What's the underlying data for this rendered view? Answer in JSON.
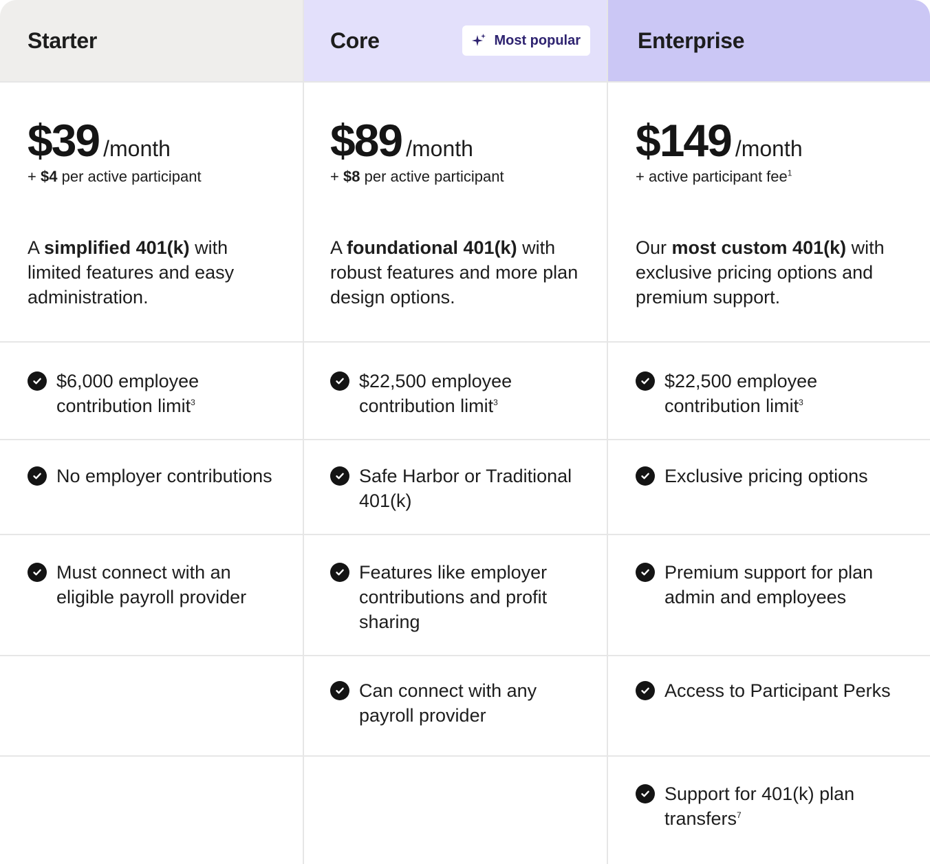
{
  "plans": [
    {
      "name": "Starter",
      "badge": null,
      "price": "$39",
      "per": "/month",
      "fee": {
        "prefix": "+",
        "amount": "$4",
        "suffix": "per active participant",
        "sup": ""
      },
      "desc": {
        "pre": "A",
        "bold": "simplified 401(k)",
        "post": "with limited features and easy administration."
      },
      "features": [
        {
          "text": "$6,000 employee contribution limit",
          "sup": "3"
        },
        {
          "text": "No employer contributions",
          "sup": ""
        },
        {
          "text": "Must connect with an eligible payroll provider",
          "sup": ""
        },
        null,
        null
      ]
    },
    {
      "name": "Core",
      "badge": {
        "label": "Most popular",
        "icon": "sparkle-icon"
      },
      "price": "$89",
      "per": "/month",
      "fee": {
        "prefix": "+",
        "amount": "$8",
        "suffix": "per active participant",
        "sup": ""
      },
      "desc": {
        "pre": "A",
        "bold": "foundational 401(k)",
        "post": "with robust features and more plan design options."
      },
      "features": [
        {
          "text": "$22,500 employee contribution limit",
          "sup": "3"
        },
        {
          "text": "Safe Harbor or Traditional 401(k)",
          "sup": ""
        },
        {
          "text": "Features like employer contributions and profit sharing",
          "sup": ""
        },
        {
          "text": "Can connect with any payroll provider",
          "sup": ""
        },
        null
      ]
    },
    {
      "name": "Enterprise",
      "badge": null,
      "price": "$149",
      "per": "/month",
      "fee": {
        "prefix": "+",
        "amount": "",
        "suffix": "active participant fee",
        "sup": "1"
      },
      "desc": {
        "pre": "Our",
        "bold": "most custom 401(k)",
        "post": "with exclusive pricing options and premium support."
      },
      "features": [
        {
          "text": "$22,500 employee contribution limit",
          "sup": "3"
        },
        {
          "text": "Exclusive pricing options",
          "sup": ""
        },
        {
          "text": "Premium support for plan admin and employees",
          "sup": ""
        },
        {
          "text": "Access to Participant Perks",
          "sup": ""
        },
        {
          "text": "Support for 401(k) plan transfers",
          "sup": "7"
        }
      ]
    }
  ],
  "colors": {
    "starter_header": "#efeeec",
    "core_header": "#e3e0fb",
    "enterprise_header": "#cbc7f5",
    "badge_text": "#2e2370",
    "check": "#141414"
  }
}
